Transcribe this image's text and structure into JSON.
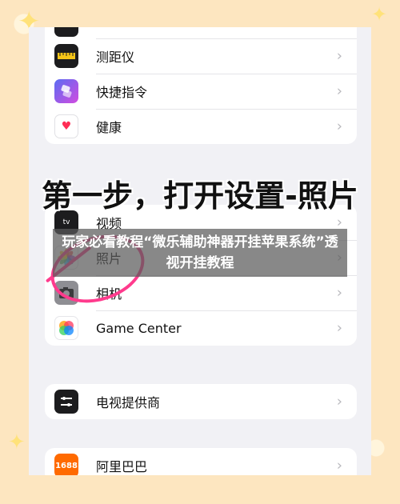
{
  "settings_groups": {
    "group1": [
      {
        "label": "测距仪",
        "icon": "measure-icon"
      },
      {
        "label": "快捷指令",
        "icon": "shortcuts-icon"
      },
      {
        "label": "健康",
        "icon": "health-icon"
      }
    ],
    "group2": [
      {
        "label": "视频",
        "icon": "tv-icon",
        "icon_text": "tv"
      },
      {
        "label": "照片",
        "icon": "photos-icon"
      },
      {
        "label": "相机",
        "icon": "camera-icon"
      },
      {
        "label": "Game Center",
        "icon": "game-center-icon"
      }
    ],
    "group3": [
      {
        "label": "电视提供商",
        "icon": "tv-provider-icon"
      }
    ],
    "group4": [
      {
        "label": "阿里巴巴",
        "icon": "alibaba-icon",
        "icon_text": "1688"
      }
    ]
  },
  "step_title": "第一步，打开设置-照片",
  "overlay": {
    "text": "玩家必看教程“微乐辅助神器开挂苹果系统”透视开挂教程"
  },
  "colors": {
    "accent_pink": "#ff3b8d",
    "background": "#f1f1f5",
    "frame": "#fde6c0"
  }
}
